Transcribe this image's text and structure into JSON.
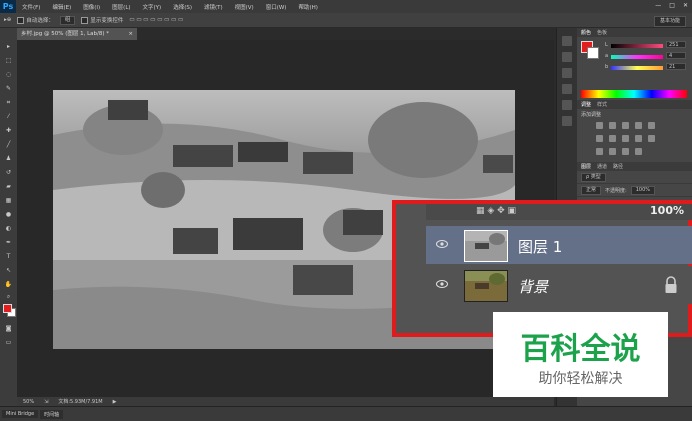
{
  "app": {
    "logo": "Ps"
  },
  "menu": [
    "文件(F)",
    "编辑(E)",
    "图像(I)",
    "图层(L)",
    "文字(Y)",
    "选择(S)",
    "滤镜(T)",
    "视图(V)",
    "窗口(W)",
    "帮助(H)"
  ],
  "window_controls": [
    "—",
    "□",
    "✕"
  ],
  "options_bar": {
    "auto_select_label": "自动选择：",
    "auto_select_value": "组",
    "show_transform_label": "显示变换控件",
    "workspace": "基本功能"
  },
  "document": {
    "tab_title": "乡村.jpg @ 50% (图层 1, Lab/8) *",
    "close": "×"
  },
  "status_bar": {
    "zoom": "50%",
    "doc_info": "文档:5.93M/7.91M",
    "arrow": "▶"
  },
  "bottom_tabs": [
    "Mini Bridge",
    "时间轴"
  ],
  "color_panel": {
    "tabs": [
      "颜色",
      "色板"
    ],
    "sliders": [
      {
        "label": "L",
        "value": "251",
        "gradient": "linear-gradient(to right,#000,#ff4b7d)"
      },
      {
        "label": "a",
        "value": "4",
        "gradient": "linear-gradient(to right,#0fb,#f3f,#f09)"
      },
      {
        "label": "b",
        "value": "21",
        "gradient": "linear-gradient(to right,#33f,#ff5,#f93)"
      }
    ]
  },
  "adjustments_panel": {
    "tabs": [
      "调整",
      "样式"
    ],
    "add_label": "添加调整"
  },
  "layers_panel": {
    "tabs": [
      "图层",
      "通道",
      "路径"
    ],
    "kind_filter": "ρ 类型",
    "blend_mode": "正常",
    "opacity_label": "不透明度:",
    "opacity_value": "100%"
  },
  "layers_overlay": {
    "opacity_fragment": "100%",
    "layers": [
      {
        "name": "图层 1",
        "selected": true,
        "locked": false
      },
      {
        "name": "背景",
        "selected": false,
        "locked": true
      }
    ]
  },
  "watermark": {
    "title": "百科全说",
    "subtitle": "助你轻松解决"
  },
  "colors": {
    "highlight_border": "#e01b1b",
    "watermark_green": "#1ca24a",
    "foreground": "#e41e1e"
  }
}
